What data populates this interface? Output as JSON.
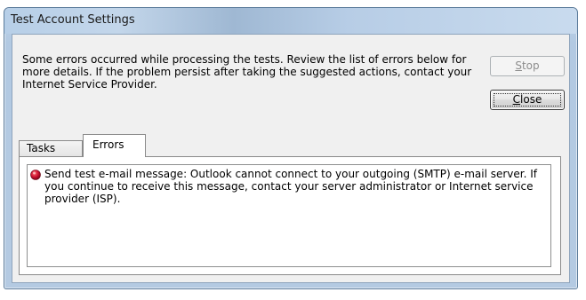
{
  "window": {
    "title": "Test Account Settings"
  },
  "message": "Some errors occurred while processing the tests. Review the list of errors below for more details. If the problem persist after taking the suggested actions, contact your Internet Service Provider.",
  "buttons": {
    "stop": {
      "label_mnemonic": "S",
      "label_rest": "top",
      "enabled": false
    },
    "close": {
      "label_mnemonic": "C",
      "label_rest": "lose",
      "enabled": true
    }
  },
  "tabs": [
    {
      "label": "Tasks",
      "selected": false
    },
    {
      "label": "Errors",
      "selected": true
    }
  ],
  "errors": [
    {
      "icon": "error-icon",
      "text": "Send test e-mail message: Outlook cannot connect to your outgoing (SMTP) e-mail server. If you continue to receive this message, contact your server administrator or Internet service provider (ISP)."
    }
  ],
  "colors": {
    "titlebar": "#b7cde5",
    "client_bg": "#f0f0f0",
    "error_icon": "#c8102e"
  }
}
